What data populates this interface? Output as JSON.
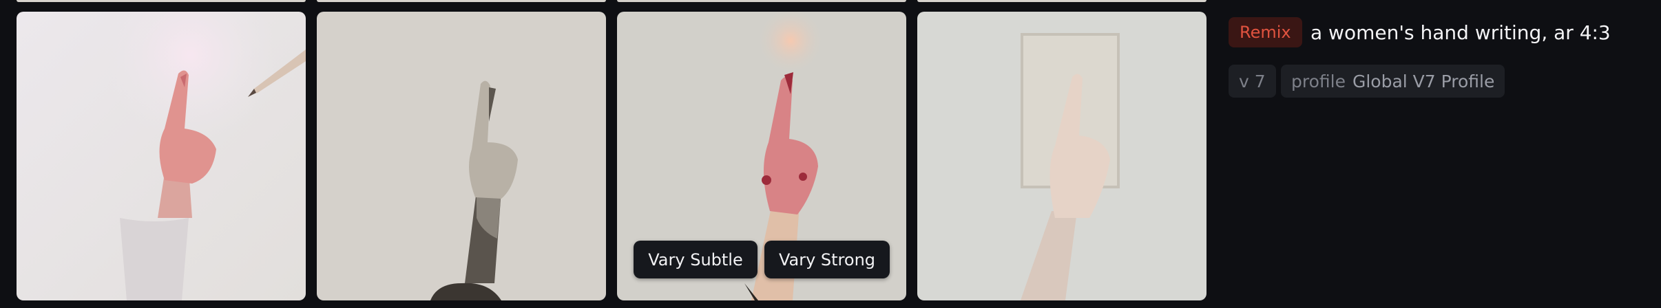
{
  "grid": {
    "images": [
      {
        "name": "image-1",
        "alt": "hand pointing up with pencil"
      },
      {
        "name": "image-2",
        "alt": "engraved hand pointing up"
      },
      {
        "name": "image-3",
        "alt": "hand with red nails pointing up"
      },
      {
        "name": "image-4",
        "alt": "pale hand pointing up with frame"
      }
    ],
    "vary_subtle_label": "Vary Subtle",
    "vary_strong_label": "Vary Strong"
  },
  "details": {
    "remix_label": "Remix",
    "prompt": "a women's hand writing, ar 4:3",
    "version_chip": "v 7",
    "profile_key": "profile",
    "profile_value": "Global V7 Profile"
  },
  "colors": {
    "background": "#0e0f13",
    "remix_bg": "#3a1614",
    "remix_text": "#e0533f",
    "chip_bg": "#1d1f24",
    "chip_text": "#7d8089"
  }
}
